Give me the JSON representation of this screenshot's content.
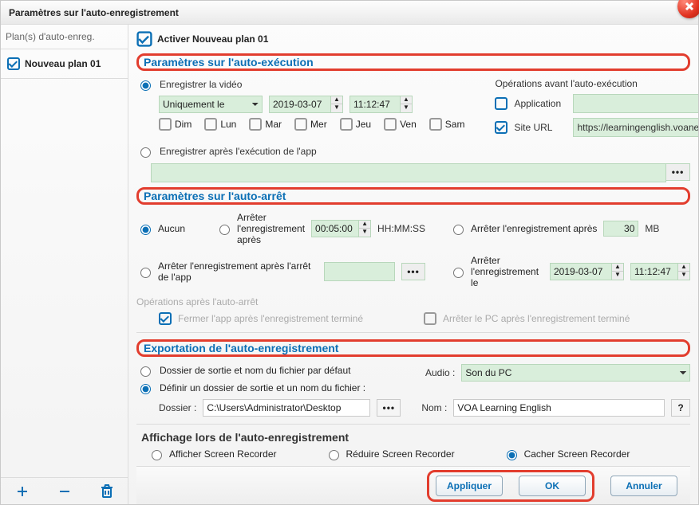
{
  "title": "Paramètres sur l'auto-enregistrement",
  "sidebar": {
    "header": "Plan(s) d'auto-enreg.",
    "items": [
      {
        "label": "Nouveau plan 01"
      }
    ]
  },
  "activate_label": "Activer Nouveau plan 01",
  "exec": {
    "title": "Paramètres sur l'auto-exécution",
    "record_video_label": "Enregistrer la vidéo",
    "record_after_app_label": "Enregistrer après l'exécution de l'app",
    "schedule_mode": "Uniquement le",
    "schedule_date": "2019-03-07",
    "schedule_time": "11:12:47",
    "days": {
      "sun": "Dim",
      "mon": "Lun",
      "tue": "Mar",
      "wed": "Mer",
      "thu": "Jeu",
      "fri": "Ven",
      "sat": "Sam"
    },
    "ops_title": "Opérations avant l'auto-exécution",
    "app_label": "Application",
    "app_value": "",
    "url_label": "Site URL",
    "url_value": "https://learningenglish.voanews."
  },
  "stop": {
    "title": "Paramètres sur l'auto-arrêt",
    "none": "Aucun",
    "after_duration": "Arrêter l'enregistrement après",
    "duration_value": "00:05:00",
    "hhmmss": "HH:MM:SS",
    "after_size": "Arrêter l'enregistrement après",
    "size_value": "30",
    "size_unit": "MB",
    "after_app": "Arrêter l'enregistrement après l'arrêt de l'app",
    "at_datetime": "Arrêter l'enregistrement le",
    "at_date": "2019-03-07",
    "at_time": "11:12:47",
    "post_ops_title": "Opérations après l'auto-arrêt",
    "close_app": "Fermer l'app après l'enregistrement terminé",
    "shutdown_pc": "Arrêter le PC après l'enregistrement terminé"
  },
  "export": {
    "title": "Exportation de l'auto-enregistrement",
    "default_output": "Dossier de sortie et nom du fichier par défaut",
    "custom_output": "Définir un dossier de sortie et un nom du fichier :",
    "audio_label": "Audio :",
    "audio_value": "Son du PC",
    "folder_label": "Dossier :",
    "folder_value": "C:\\Users\\Administrator\\Desktop",
    "name_label": "Nom :",
    "name_value": "VOA Learning English"
  },
  "display": {
    "title": "Affichage lors de l'auto-enregistrement",
    "show": "Afficher Screen Recorder",
    "reduce": "Réduire Screen Recorder",
    "hide": "Cacher Screen Recorder"
  },
  "buttons": {
    "apply": "Appliquer",
    "ok": "OK",
    "cancel": "Annuler"
  }
}
